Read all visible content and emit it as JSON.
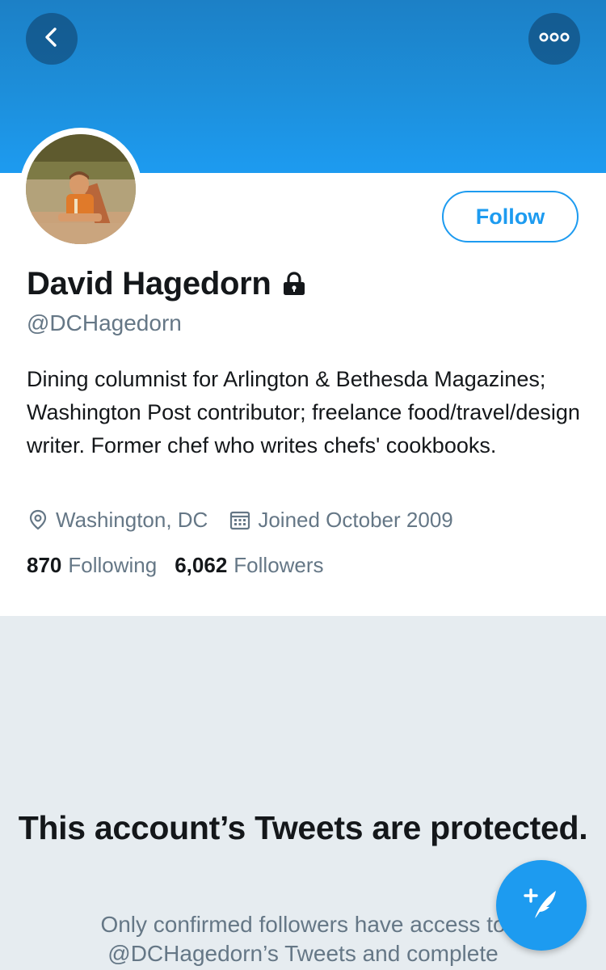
{
  "header": {
    "back_icon": "chevron-left-icon",
    "more_icon": "more-dots-icon",
    "banner_color": "#1d9bf0"
  },
  "profile": {
    "name": "David Hagedorn",
    "protected_icon": "lock-icon",
    "handle": "@DCHagedorn",
    "bio": "Dining columnist for Arlington & Bethesda Magazines; Washington Post contributor; freelance food/travel/design writer. Former chef who writes chefs' cookbooks.",
    "location": "Washington, DC",
    "joined": "Joined October 2009",
    "following_count": "870",
    "following_label": "Following",
    "followers_count": "6,062",
    "followers_label": "Followers",
    "follow_button_label": "Follow"
  },
  "protected_notice": {
    "title": "This account’s Tweets are protected.",
    "description": "Only confirmed followers have access to @DCHagedorn’s Tweets and complete"
  },
  "compose": {
    "icon": "compose-tweet-icon"
  },
  "colors": {
    "accent": "#1d9bf0",
    "text_primary": "#14171a",
    "text_secondary": "#657786",
    "protected_bg": "#e6ecf0"
  }
}
